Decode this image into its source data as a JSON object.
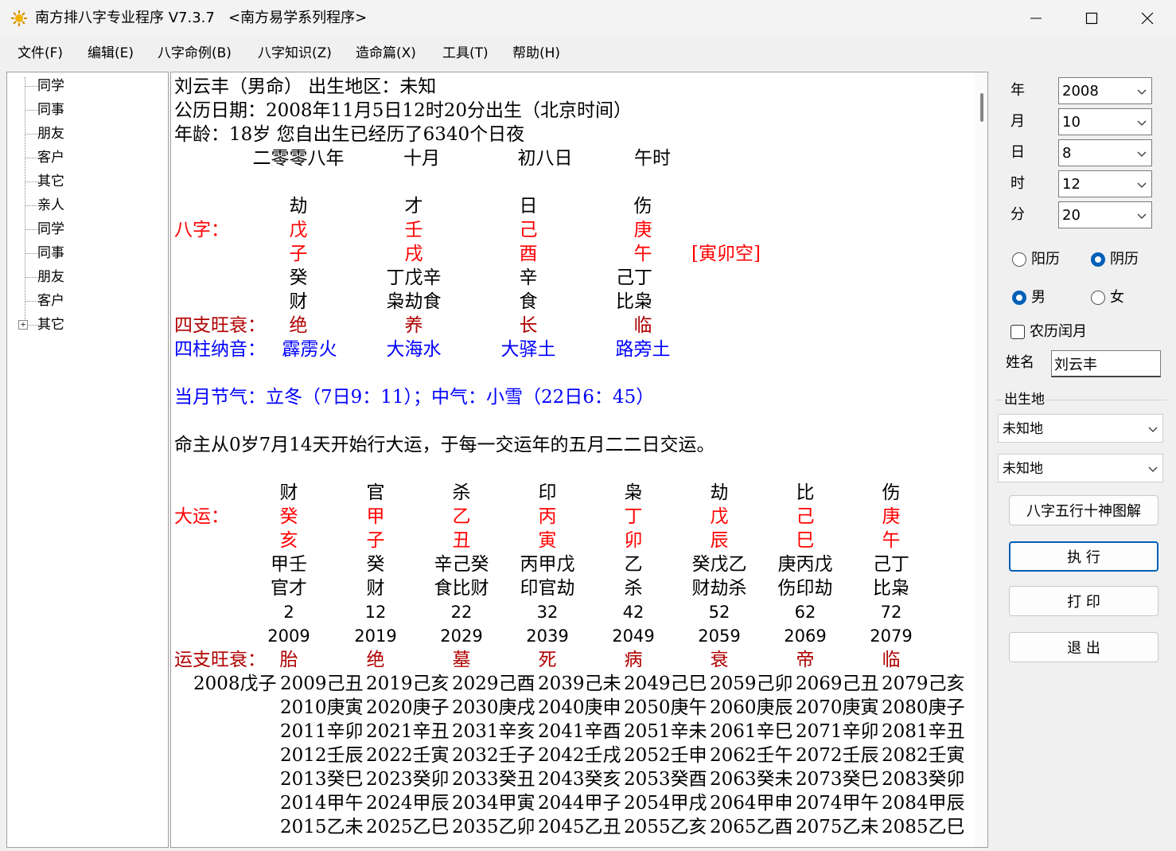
{
  "window": {
    "title": "南方排八字专业程序 V7.3.7   <南方易学系列程序>"
  },
  "menu": [
    "文件(F)",
    "编辑(E)",
    "八字命例(B)",
    "八字知识(Z)",
    "造命篇(X)",
    "工具(T)",
    "帮助(H)"
  ],
  "tree": [
    "同学",
    "同事",
    "朋友",
    "客户",
    "其它",
    "亲人",
    "同学",
    "同事",
    "朋友",
    "客户",
    "其它"
  ],
  "report": {
    "line1": "刘云丰（男命） 出生地区：未知",
    "line2": "公历日期：2008年11月5日12时20分出生（北京时间）",
    "line3": "年龄：18岁    您自出生已经历了6340个日夜",
    "lunar": [
      "二零零八年",
      "十月",
      "初八日",
      "午时"
    ],
    "gods_top": [
      "劫",
      "才",
      "日",
      "伤"
    ],
    "bazi_label": "八字：",
    "stems": [
      "戊",
      "壬",
      "己",
      "庚"
    ],
    "branches": [
      "子",
      "戌",
      "酉",
      "午"
    ],
    "kong": "[寅卯空]",
    "hidden": [
      "癸",
      "丁戊辛",
      "辛",
      "己丁"
    ],
    "hidden_gods": [
      "财",
      "枭劫食",
      "食",
      "比枭"
    ],
    "wangshuai_label": "四支旺衰：",
    "wangshuai": [
      "绝",
      "养",
      "长",
      "临"
    ],
    "nayin_label": "四柱纳音：",
    "nayin": [
      "霹雳火",
      "大海水",
      "大驿土",
      "路旁土"
    ],
    "jieqi": "当月节气：立冬（7日9：11）；中气：小雪（22日6：45）",
    "qiyun": "命主从0岁7月14天开始行大运，于每一交运年的五月二二日交运。",
    "dayun_label": "大运：",
    "dayun_gods": [
      "财",
      "官",
      "杀",
      "印",
      "枭",
      "劫",
      "比",
      "伤"
    ],
    "dayun_stems": [
      "癸",
      "甲",
      "乙",
      "丙",
      "丁",
      "戊",
      "己",
      "庚"
    ],
    "dayun_branches": [
      "亥",
      "子",
      "丑",
      "寅",
      "卯",
      "辰",
      "巳",
      "午"
    ],
    "dayun_hidden": [
      "甲壬",
      "癸",
      "辛己癸",
      "丙甲戊",
      "乙",
      "癸戊乙",
      "庚丙戊",
      "己丁"
    ],
    "dayun_hidden_gods": [
      "官才",
      "财",
      "食比财",
      "印官劫",
      "杀",
      "财劫杀",
      "伤印劫",
      "比枭"
    ],
    "dayun_ages": [
      "2",
      "12",
      "22",
      "32",
      "42",
      "52",
      "62",
      "72"
    ],
    "dayun_years": [
      "2009",
      "2019",
      "2029",
      "2039",
      "2049",
      "2059",
      "2069",
      "2079"
    ],
    "yun_ws_label": "运支旺衰：",
    "yun_ws": [
      "胎",
      "绝",
      "墓",
      "死",
      "病",
      "衰",
      "帝",
      "临"
    ],
    "birth_year": "2008戊子",
    "liunian": [
      [
        "2009己丑",
        "2019己亥",
        "2029己酉",
        "2039己未",
        "2049己巳",
        "2059己卯",
        "2069己丑",
        "2079己亥"
      ],
      [
        "2010庚寅",
        "2020庚子",
        "2030庚戌",
        "2040庚申",
        "2050庚午",
        "2060庚辰",
        "2070庚寅",
        "2080庚子"
      ],
      [
        "2011辛卯",
        "2021辛丑",
        "2031辛亥",
        "2041辛酉",
        "2051辛未",
        "2061辛巳",
        "2071辛卯",
        "2081辛丑"
      ],
      [
        "2012壬辰",
        "2022壬寅",
        "2032壬子",
        "2042壬戌",
        "2052壬申",
        "2062壬午",
        "2072壬辰",
        "2082壬寅"
      ],
      [
        "2013癸巳",
        "2023癸卯",
        "2033癸丑",
        "2043癸亥",
        "2053癸酉",
        "2063癸未",
        "2073癸巳",
        "2083癸卯"
      ],
      [
        "2014甲午",
        "2024甲辰",
        "2034甲寅",
        "2044甲子",
        "2054甲戌",
        "2064甲申",
        "2074甲午",
        "2084甲辰"
      ],
      [
        "2015乙未",
        "2025乙巳",
        "2035乙卯",
        "2045乙丑",
        "2055乙亥",
        "2065乙酉",
        "2075乙未",
        "2085乙巳"
      ]
    ]
  },
  "form": {
    "year_label": "年",
    "year": "2008",
    "month_label": "月",
    "month": "10",
    "day_label": "日",
    "day": "8",
    "hour_label": "时",
    "hour": "12",
    "minute_label": "分",
    "minute": "20",
    "solar": "阳历",
    "lunar": "阴历",
    "male": "男",
    "female": "女",
    "leap": "农历闰月",
    "name_label": "姓名",
    "name": "刘云丰",
    "birth_label": "出生地",
    "place1": "未知地",
    "place2": "未知地",
    "btn_chart": "八字五行十神图解",
    "btn_run": "执 行",
    "btn_print": "打 印",
    "btn_exit": "退 出"
  },
  "colors": {
    "red": "#ff0000",
    "dark_red": "#b00000",
    "blue": "#0000ff",
    "accent": "#005fb8"
  }
}
